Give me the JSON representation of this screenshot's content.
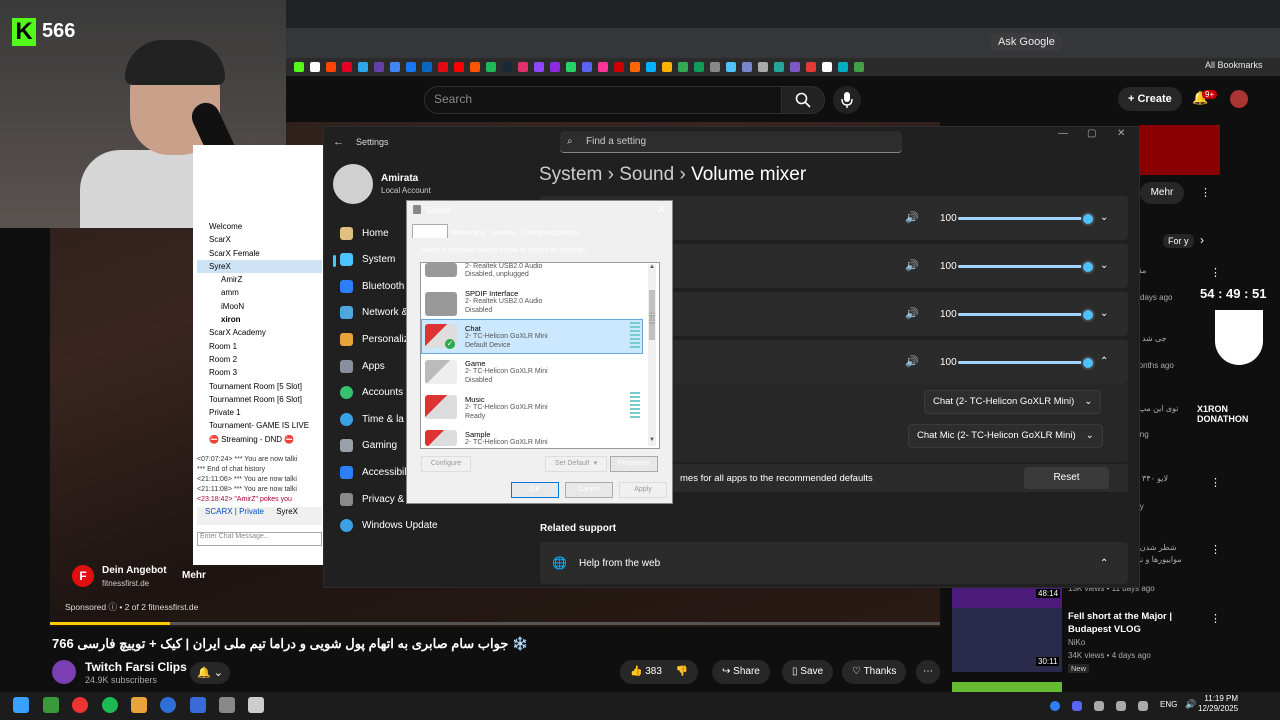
{
  "webcam": {
    "kick_count": "566",
    "kick_logo": "K"
  },
  "browser": {
    "ask_google": "Ask Google",
    "all_bookmarks": "All Bookmarks"
  },
  "youtube": {
    "search_placeholder": "Search",
    "create_label": "Create",
    "notif_badge": "9+",
    "ad": {
      "logo": "F",
      "title": "Dein Angebot",
      "domain": "fitnessfirst.de",
      "cta": "Mehr"
    },
    "sponsored": "Sponsored  ⓘ • 2 of 2   fitnessfirst.de",
    "video_title": "766 جواب سام صابری به اتهام پول شویی و دراما تیم ملی ایران | کیک + توییچ فارسی ❄️",
    "channel": {
      "name": "Twitch Farsi Clips",
      "subs": "24.9K subscribers"
    },
    "actions": {
      "likes": "383",
      "share": "Share",
      "save": "Save",
      "thanks": "Thanks"
    },
    "sidebar": {
      "mehr": "Mehr",
      "for_you": "For y",
      "timer": "54 : 49 : 51",
      "donathon": "X1RON DONATHON",
      "rec1_meta": "13K views • 11 days ago",
      "rec1_duration": "48:14",
      "rec2_title": "Fell short at the Major | Budapest VLOG",
      "rec2_channel": "NiKo",
      "rec2_meta": "34K views • 4 days ago",
      "rec2_badge": "New",
      "rec2_duration": "30:11",
      "snippets": [
        "مقاوما",
        "days ago",
        "جی شد جی",
        "months ago",
        "توی این مپ زنده",
        "ing",
        "لایو ۳۴۰ با ماه",
        "ly",
        "وی",
        "شطر شدن دران",
        "مواییورها و تولد از",
        "ago"
      ]
    }
  },
  "irc": {
    "tree": [
      "Welcome",
      "ScarX",
      "ScarX Female",
      "SyreX",
      "AmirZ",
      "amm",
      "iMooN",
      "xiron",
      "ScarX Academy",
      "Room 1",
      "Room 2",
      "Room 3",
      "Tournament Room [5 Slot]",
      "Tournamnet Room [6 Slot]",
      "Private 1",
      "Tournament- GAME IS LIVE",
      "⛔ Streaming - DND ⛔"
    ],
    "log": [
      "<07:07:24> *** You are now talki",
      "*** End of chat history",
      "<21:11:06> *** You are now talki",
      "<21:11:08> *** You are now talki",
      "<23:18:42> \"AmirZ\" pokes you"
    ],
    "tabs": [
      "SCARX | Private",
      "SyreX"
    ],
    "input_placeholder": "Enter Chat Message..."
  },
  "settings": {
    "title": "Settings",
    "search_placeholder": "Find a setting",
    "user_name": "Amirata",
    "user_type": "Local Account",
    "nav": [
      "Home",
      "System",
      "Bluetooth",
      "Network &",
      "Personaliza",
      "Apps",
      "Accounts",
      "Time & la",
      "Gaming",
      "Accessibili",
      "Privacy & security",
      "Windows Update"
    ],
    "breadcrumb": {
      "a": "System",
      "b": "Sound",
      "c": "Volume mixer",
      "sep": "›"
    },
    "volumes": [
      "100",
      "100",
      "100",
      "100"
    ],
    "output_device": "Chat (2- TC-Helicon GoXLR Mini)",
    "input_device": "Chat Mic (2- TC-Helicon GoXLR Mini)",
    "reset_text": "mes for all apps to the recommended defaults",
    "reset_button": "Reset",
    "related_support": "Related support",
    "help_web": "Help from the web"
  },
  "sound_dialog": {
    "title": "Sound",
    "tabs": [
      "Playback",
      "Recording",
      "Sounds",
      "Communications"
    ],
    "description": "Select a playback device below to modify its settings:",
    "devices": [
      {
        "name": "",
        "sub1": "2- Realtek USB2.0 Audio",
        "sub2": "Disabled, unplugged"
      },
      {
        "name": "SPDIF Interface",
        "sub1": "2- Realtek USB2.0 Audio",
        "sub2": "Disabled"
      },
      {
        "name": "Chat",
        "sub1": "2- TC-Helicon GoXLR Mini",
        "sub2": "Default Device"
      },
      {
        "name": "Game",
        "sub1": "2- TC-Helicon GoXLR Mini",
        "sub2": "Disabled"
      },
      {
        "name": "Music",
        "sub1": "2- TC-Helicon GoXLR Mini",
        "sub2": "Ready"
      },
      {
        "name": "Sample",
        "sub1": "2- TC-Helicon GoXLR Mini",
        "sub2": ""
      }
    ],
    "configure": "Configure",
    "set_default": "Set Default",
    "properties": "Properties",
    "ok": "OK",
    "cancel": "Cancel",
    "apply": "Apply"
  },
  "taskbar": {
    "lang": "ENG",
    "time": "11:19 PM",
    "date": "12/29/2025"
  }
}
